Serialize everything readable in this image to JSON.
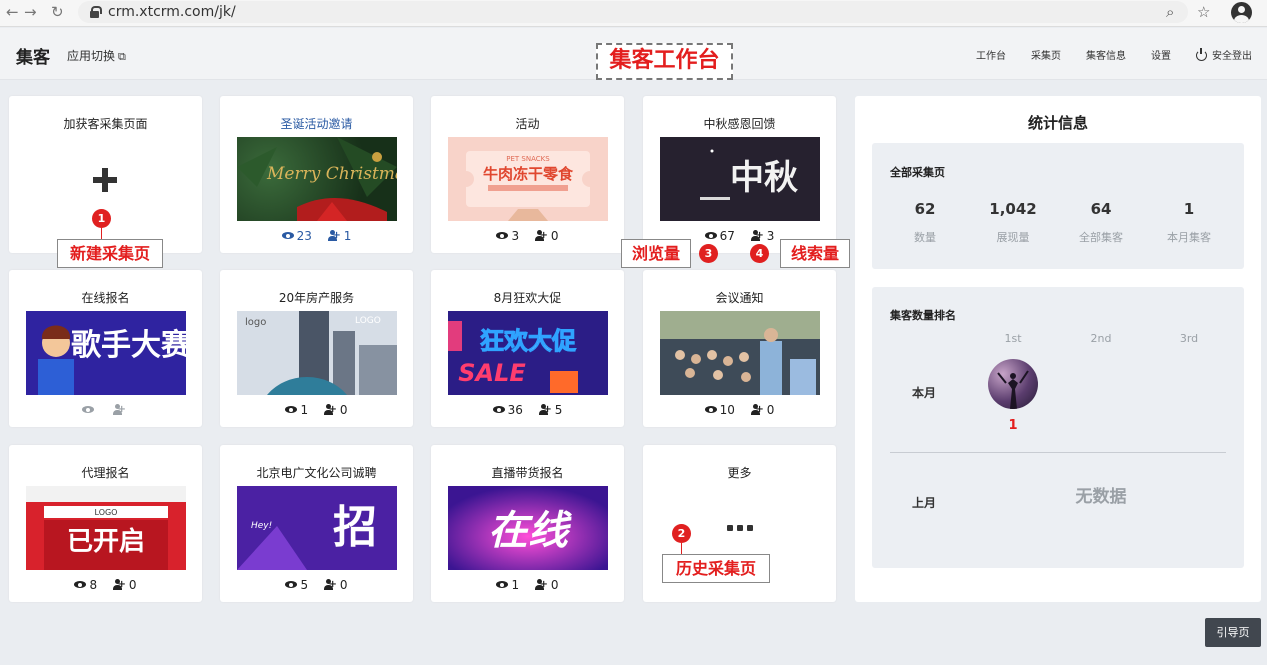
{
  "browser": {
    "url": "crm.xtcrm.com/jk/"
  },
  "header": {
    "brand": "集客",
    "app_switch": "应用切换",
    "nav": [
      "工作台",
      "采集页",
      "集客信息",
      "设置"
    ],
    "logout": "安全登出",
    "title_annotation": "集客工作台"
  },
  "cards": [
    {
      "title": "加获客采集页面",
      "type": "add"
    },
    {
      "title": "圣诞活动邀请",
      "views": "23",
      "leads": "1",
      "thumb_text": "Merry Christmas",
      "style": "link"
    },
    {
      "title": "活动",
      "views": "3",
      "leads": "0",
      "thumb_text": "牛肉冻干零食",
      "thumb_sub": "PET SNACKS"
    },
    {
      "title": "中秋感恩回馈",
      "views": "67",
      "leads": "3",
      "thumb_text": "中秋"
    },
    {
      "title": "在线报名",
      "views": "",
      "leads": "",
      "thumb_text": "歌手大赛"
    },
    {
      "title": "20年房产服务",
      "views": "1",
      "leads": "0",
      "thumb_text": "logo",
      "thumb_sub": "LOGO"
    },
    {
      "title": "8月狂欢大促",
      "views": "36",
      "leads": "5",
      "thumb_text": "狂欢大促",
      "thumb_sub": "SALE"
    },
    {
      "title": "会议通知",
      "views": "10",
      "leads": "0"
    },
    {
      "title": "代理报名",
      "views": "8",
      "leads": "0",
      "thumb_text": "已开启",
      "thumb_sub": "LOGO"
    },
    {
      "title": "北京电广文化公司诚聘",
      "views": "5",
      "leads": "0",
      "thumb_text": "招",
      "thumb_sub": "Hey!"
    },
    {
      "title": "直播带货报名",
      "views": "1",
      "leads": "0",
      "thumb_text": "在线"
    },
    {
      "title": "更多",
      "type": "more"
    }
  ],
  "annotations": [
    {
      "num": "1",
      "label": "新建采集页"
    },
    {
      "num": "2",
      "label": "历史采集页"
    },
    {
      "num": "3",
      "label": "浏览量"
    },
    {
      "num": "4",
      "label": "线索量"
    }
  ],
  "stats": {
    "title": "统计信息",
    "all_pages": {
      "title": "全部采集页",
      "metrics": [
        {
          "value": "62",
          "label": "数量"
        },
        {
          "value": "1,042",
          "label": "展现量"
        },
        {
          "value": "64",
          "label": "全部集客"
        },
        {
          "value": "1",
          "label": "本月集客"
        }
      ]
    },
    "ranking": {
      "title": "集客数量排名",
      "headers": [
        "1st",
        "2nd",
        "3rd"
      ],
      "this_month_label": "本月",
      "this_month_first_count": "1",
      "last_month_label": "上月",
      "no_data": "无数据"
    }
  },
  "guide_button": "引导页",
  "colors": {
    "accent_red": "#e31e1e",
    "link_blue": "#2a5aa3",
    "page_bg": "#eaedf1"
  },
  "icons": [
    "lock-icon",
    "zoom-icon",
    "star-icon",
    "account-icon",
    "external-link-icon",
    "power-icon",
    "eye-icon",
    "user-plus-icon",
    "plus-icon",
    "more-dots-icon"
  ]
}
